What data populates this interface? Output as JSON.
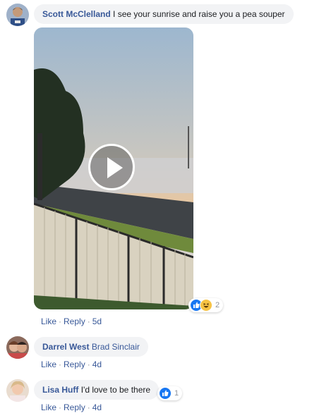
{
  "comments": [
    {
      "author": "Scott McClelland",
      "text": "I see your sunrise and raise you a pea souper",
      "actions": {
        "like": "Like",
        "reply": "Reply",
        "time": "5d"
      },
      "reactions": {
        "count": "2",
        "icons": [
          "like-icon",
          "haha-icon"
        ]
      },
      "attachment": {
        "type": "video",
        "overlay_icon": "play-icon"
      }
    },
    {
      "author": "Darrel West",
      "tagged": "Brad Sinclair",
      "actions": {
        "like": "Like",
        "reply": "Reply",
        "time": "4d"
      }
    },
    {
      "author": "Lisa Huff",
      "text": "I'd love to be there",
      "actions": {
        "like": "Like",
        "reply": "Reply",
        "time": "4d"
      },
      "reactions": {
        "count": "1",
        "icons": [
          "like-icon"
        ]
      }
    }
  ],
  "colors": {
    "link": "#385898",
    "bubble": "#f2f3f5",
    "meta": "#90949c",
    "like_blue": "#1877f2",
    "haha_yellow": "#f7c344"
  }
}
